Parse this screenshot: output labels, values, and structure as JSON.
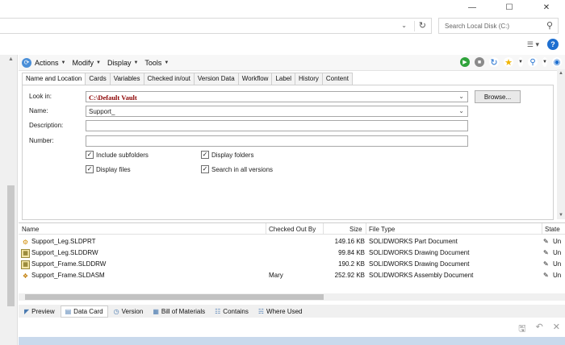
{
  "window": {
    "minimize": "—",
    "maximize": "☐",
    "close": "✕"
  },
  "address": {
    "dropdown_icon": "chevron-down-icon",
    "refresh_icon": "refresh-icon"
  },
  "search": {
    "placeholder": "Search Local Disk (C:)"
  },
  "menu": {
    "items": [
      "Actions",
      "Modify",
      "Display",
      "Tools"
    ]
  },
  "tabs": [
    "Name and Location",
    "Cards",
    "Variables",
    "Checked in/out",
    "Version Data",
    "Workflow",
    "Label",
    "History",
    "Content"
  ],
  "form": {
    "look_in_label": "Look in:",
    "look_in_value": "C:\\Default Vault",
    "name_label": "Name:",
    "name_value": "Support_",
    "description_label": "Description:",
    "description_value": "",
    "number_label": "Number:",
    "number_value": "",
    "browse_label": "Browse...",
    "checkboxes": [
      {
        "label": "Include subfolders",
        "checked": true
      },
      {
        "label": "Display folders",
        "checked": true
      },
      {
        "label": "Display files",
        "checked": true
      },
      {
        "label": "Search in all versions",
        "checked": true
      }
    ]
  },
  "filelist": {
    "columns": [
      "Name",
      "Checked Out By",
      "Size",
      "File Type",
      "State"
    ],
    "rows": [
      {
        "name": "Support_Leg.SLDPRT",
        "checked_out_by": "",
        "size": "149.16 KB",
        "type": "SOLIDWORKS Part Document",
        "state": "Un",
        "icon": "part"
      },
      {
        "name": "Support_Leg.SLDDRW",
        "checked_out_by": "",
        "size": "99.84 KB",
        "type": "SOLIDWORKS Drawing Document",
        "state": "Un",
        "icon": "drawing"
      },
      {
        "name": "Support_Frame.SLDDRW",
        "checked_out_by": "",
        "size": "190.2 KB",
        "type": "SOLIDWORKS Drawing Document",
        "state": "Un",
        "icon": "drawing"
      },
      {
        "name": "Support_Frame.SLDASM",
        "checked_out_by": "Mary",
        "size": "252.92 KB",
        "type": "SOLIDWORKS Assembly Document",
        "state": "Un",
        "icon": "assembly"
      }
    ]
  },
  "bottom_tabs": [
    "Preview",
    "Data Card",
    "Version",
    "Bill of Materials",
    "Contains",
    "Where Used"
  ],
  "colors": {
    "accent": "#1e6fd0",
    "look_in_text": "#8b0000",
    "preview_bar": "#c9d9ec"
  }
}
